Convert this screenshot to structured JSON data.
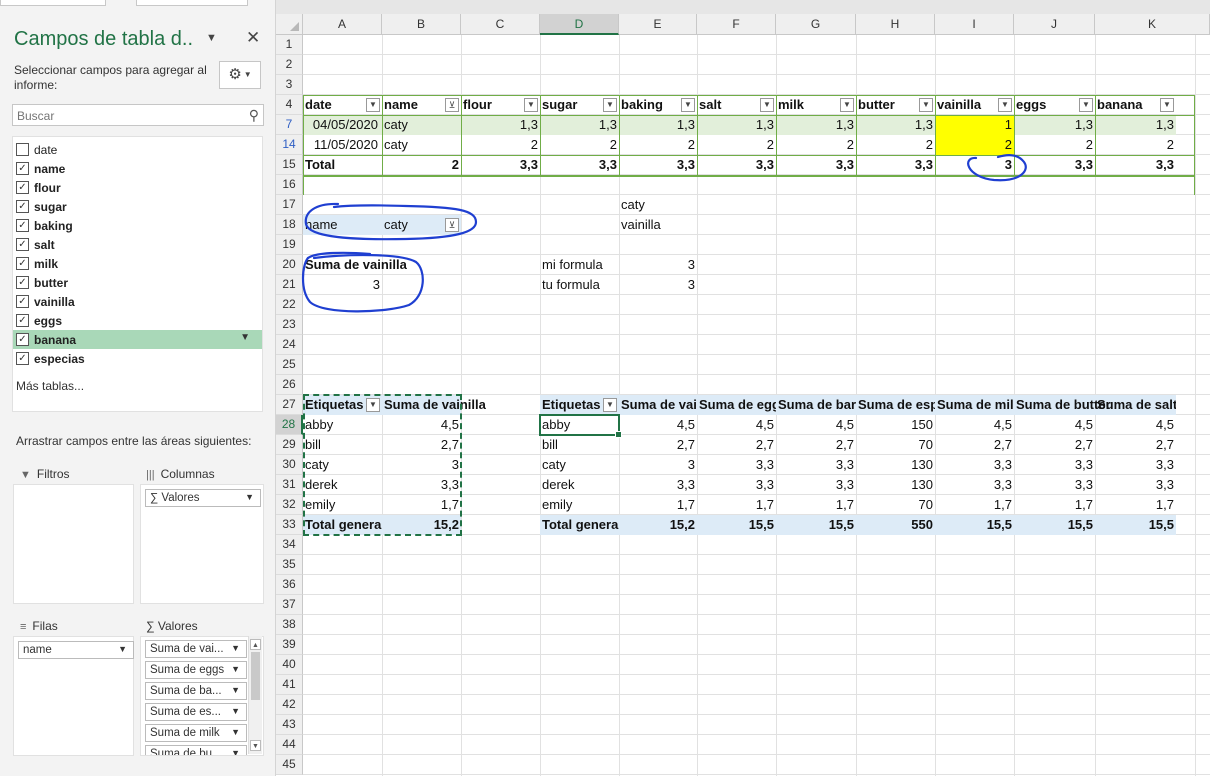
{
  "pane": {
    "title": "Campos de tabla d..",
    "close": "✕",
    "hint": "Seleccionar campos para agregar al informe:",
    "search_placeholder": "Buscar",
    "fields": [
      {
        "label": "date",
        "checked": false
      },
      {
        "label": "name",
        "checked": true
      },
      {
        "label": "flour",
        "checked": true
      },
      {
        "label": "sugar",
        "checked": true
      },
      {
        "label": "baking",
        "checked": true
      },
      {
        "label": "salt",
        "checked": true
      },
      {
        "label": "milk",
        "checked": true
      },
      {
        "label": "butter",
        "checked": true
      },
      {
        "label": "vainilla",
        "checked": true
      },
      {
        "label": "eggs",
        "checked": true
      },
      {
        "label": "banana",
        "checked": true
      },
      {
        "label": "especias",
        "checked": true
      }
    ],
    "more_tables": "Más tablas...",
    "drag_hint": "Arrastrar campos entre las áreas siguientes:",
    "areas": {
      "filters_label": "Filtros",
      "columns_label": "Columnas",
      "columns_items": [
        "∑ Valores"
      ],
      "rows_label": "Filas",
      "rows_items": [
        "name"
      ],
      "values_label": "∑  Valores",
      "values_items": [
        "Suma de vai...",
        "Suma de eggs",
        "Suma de ba...",
        "Suma de es...",
        "Suma de milk",
        "Suma de bu..."
      ]
    }
  },
  "sheet": {
    "columns": [
      "A",
      "B",
      "C",
      "D",
      "E",
      "F",
      "G",
      "H",
      "I",
      "J",
      "K"
    ],
    "active_column": "D",
    "active_row": "28",
    "rows": [
      "1",
      "2",
      "3",
      "4",
      "7",
      "14",
      "15",
      "16",
      "17",
      "18",
      "19",
      "20",
      "21",
      "22",
      "23",
      "24",
      "25",
      "26",
      "27",
      "28",
      "29",
      "30",
      "31",
      "32",
      "33",
      "34",
      "35",
      "36",
      "37",
      "38",
      "39",
      "40",
      "41",
      "42",
      "43",
      "44",
      "45"
    ],
    "table1": {
      "headers": [
        "date",
        "name",
        "flour",
        "sugar",
        "baking",
        "salt",
        "milk",
        "butter",
        "vainilla",
        "eggs",
        "banana"
      ],
      "row7": [
        "04/05/2020",
        "caty",
        "1,3",
        "1,3",
        "1,3",
        "1,3",
        "1,3",
        "1,3",
        "1",
        "1,3",
        "1,3"
      ],
      "row14": [
        "11/05/2020",
        "caty",
        "2",
        "2",
        "2",
        "2",
        "2",
        "2",
        "2",
        "2",
        "2"
      ],
      "total": [
        "Total",
        "2",
        "3,3",
        "3,3",
        "3,3",
        "3,3",
        "3,3",
        "3,3",
        "3",
        "3,3",
        "3,3"
      ]
    },
    "caty_text": "caty",
    "vainilla_text": "vainilla",
    "filter_label": "name",
    "filter_value": "caty",
    "suma_header": "Suma de vainilla",
    "suma_value": "3",
    "mi_formula": "mi formula",
    "mi_value": "3",
    "tu_formula": "tu formula",
    "tu_value": "3",
    "pivot_left": {
      "h1": "Etiquetas",
      "h2": "Suma de vainilla",
      "rows": [
        [
          "abby",
          "4,5"
        ],
        [
          "bill",
          "2,7"
        ],
        [
          "caty",
          "3"
        ],
        [
          "derek",
          "3,3"
        ],
        [
          "emily",
          "1,7"
        ]
      ],
      "total": [
        "Total genera",
        "15,2"
      ]
    },
    "pivot_right": {
      "headers": [
        "Etiquetas",
        "Suma de vai",
        "Suma de egg",
        "Suma de bar",
        "Suma de esp",
        "Suma de mil",
        "Suma de butter",
        "Suma de salt"
      ],
      "rows": [
        [
          "abby",
          "4,5",
          "4,5",
          "4,5",
          "150",
          "4,5",
          "4,5",
          "4,5"
        ],
        [
          "bill",
          "2,7",
          "2,7",
          "2,7",
          "70",
          "2,7",
          "2,7",
          "2,7"
        ],
        [
          "caty",
          "3",
          "3,3",
          "3,3",
          "130",
          "3,3",
          "3,3",
          "3,3"
        ],
        [
          "derek",
          "3,3",
          "3,3",
          "3,3",
          "130",
          "3,3",
          "3,3",
          "3,3"
        ],
        [
          "emily",
          "1,7",
          "1,7",
          "1,7",
          "70",
          "1,7",
          "1,7",
          "1,7"
        ]
      ],
      "total": [
        "Total genera",
        "15,2",
        "15,5",
        "15,5",
        "550",
        "15,5",
        "15,5",
        "15,5"
      ]
    }
  },
  "colors": {
    "accent": "#217346",
    "highlight": "#ffff00",
    "ink": "#1f3fd1",
    "table_green": "#e2efda",
    "pivot_blue": "#ddebf7"
  }
}
